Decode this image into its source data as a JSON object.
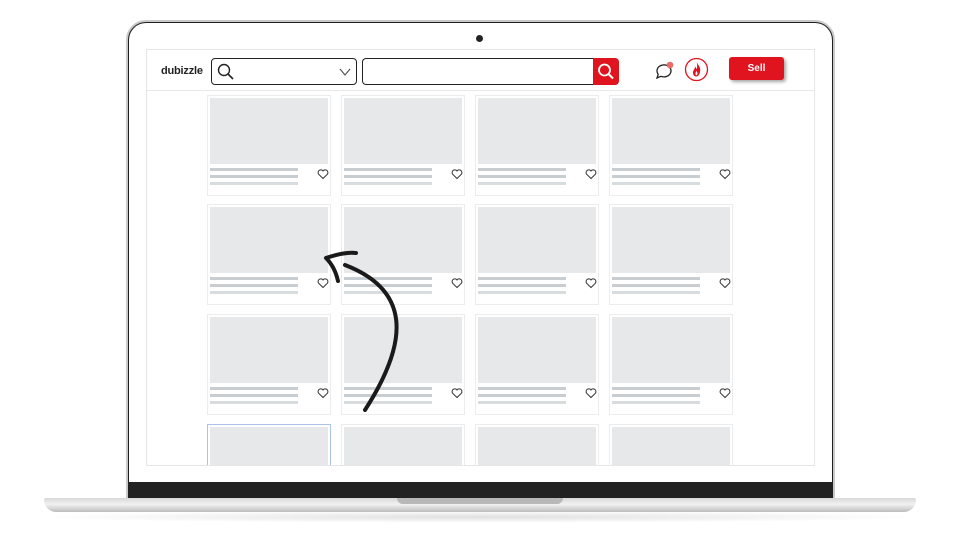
{
  "header": {
    "logo": "dubizzle",
    "location_placeholder": "",
    "search_placeholder": "",
    "sell_label": "Sell"
  },
  "icons": {
    "location": "search-icon",
    "dropdown": "chevron-down-icon",
    "search": "search-icon",
    "chat": "chat-icon",
    "notifications": "fire-icon",
    "favorite": "heart-icon"
  },
  "colors": {
    "brand_red": "#e0141e",
    "placeholder_gray": "#e6e8e9",
    "line_gray": "#c7cdd1",
    "notification_dot": "#ec6a6a"
  },
  "listings": {
    "rows": 4,
    "columns": 4,
    "selected_index": 12
  }
}
